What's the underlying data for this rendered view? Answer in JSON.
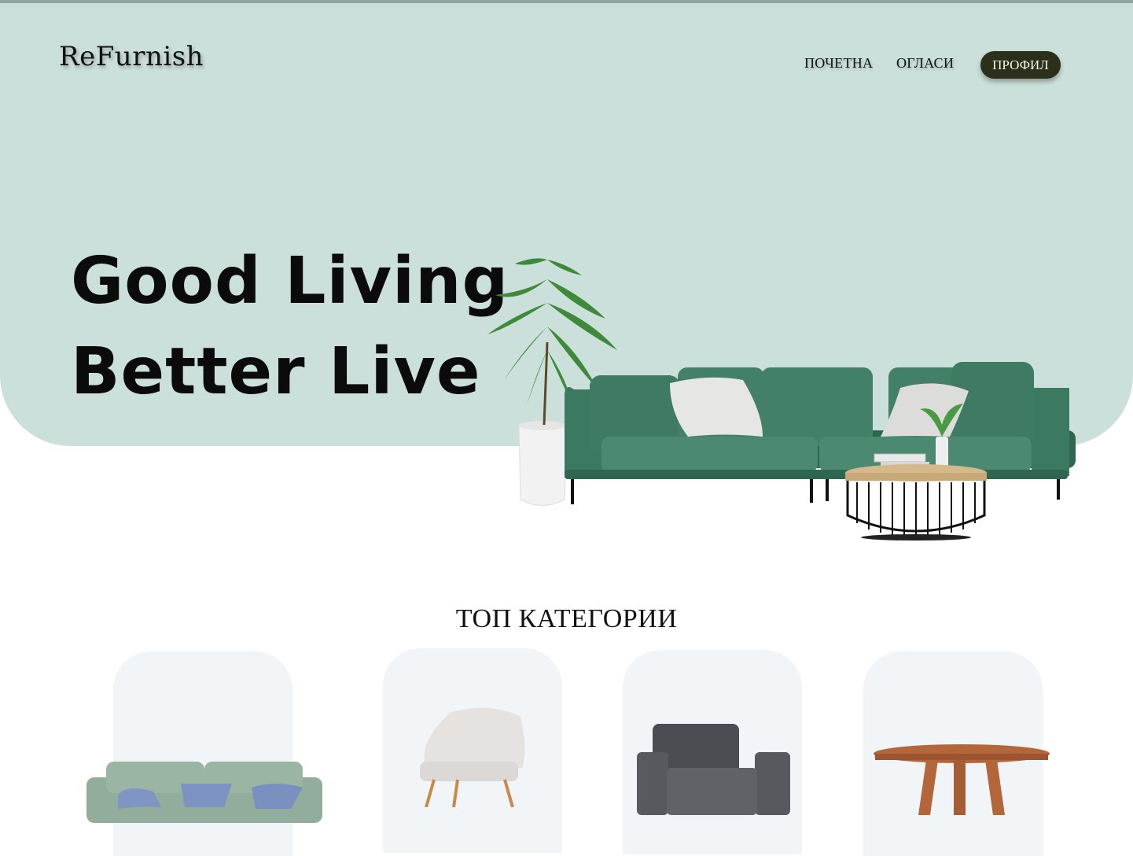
{
  "brand": "ReFurnish",
  "nav": {
    "home": "ПОЧЕТНА",
    "ads": "ОГЛАСИ",
    "profile": "ПРОФИЛ"
  },
  "hero": {
    "line1": "Good Living",
    "line2": "Better Live"
  },
  "categories": {
    "title": "ТОП КАТЕГОРИИ"
  },
  "colors": {
    "hero_bg": "#cbe0da",
    "profile_button": "#2c301b",
    "sofa": "#3f7a62",
    "card_bg": "#f1f5f8"
  }
}
